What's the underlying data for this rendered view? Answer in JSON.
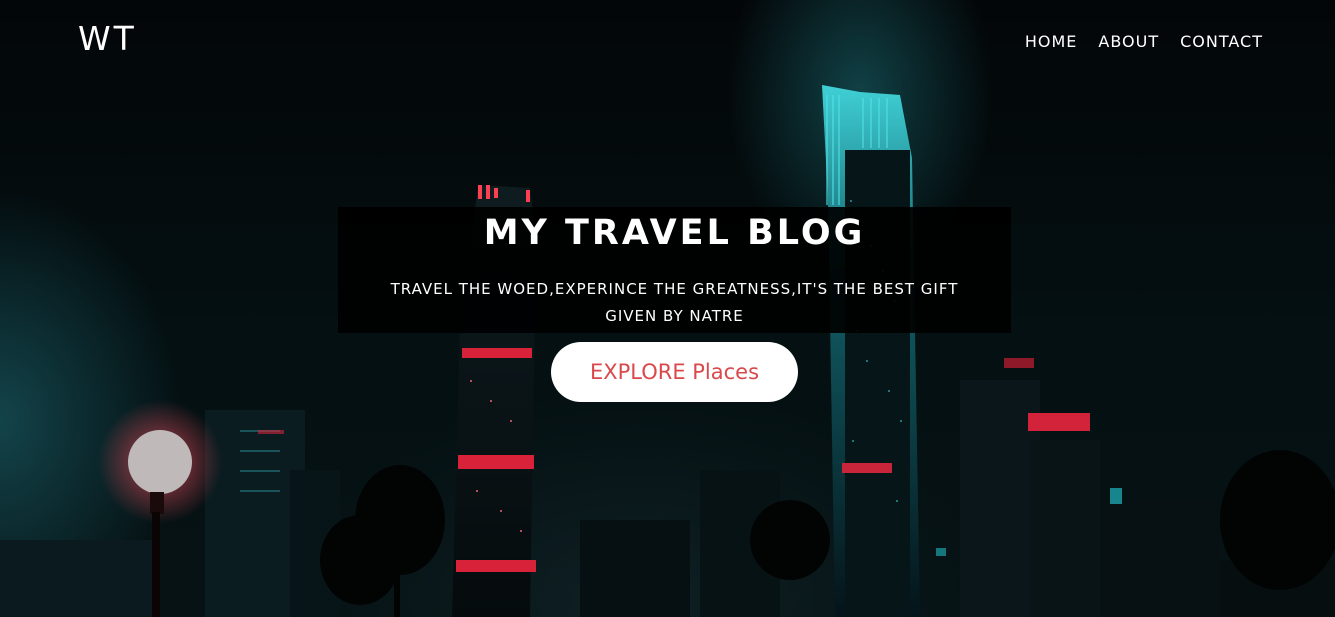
{
  "nav": {
    "logo": "WT",
    "links": [
      "HOME",
      "ABOUT",
      "CONTACT"
    ]
  },
  "hero": {
    "title": "MY TRAVEL BLOG",
    "subtitle_line1": "TRAVEL THE WOED,EXPERINCE THE GREATNESS,IT'S THE BEST GIFT",
    "subtitle_line2": "GIVEN BY NATRE",
    "button_label": "EXPLORE Places"
  },
  "colors": {
    "button_text": "#d9494c",
    "button_bg": "#ffffff",
    "accent_teal": "#2aa7ad",
    "accent_red": "#e0263a"
  }
}
